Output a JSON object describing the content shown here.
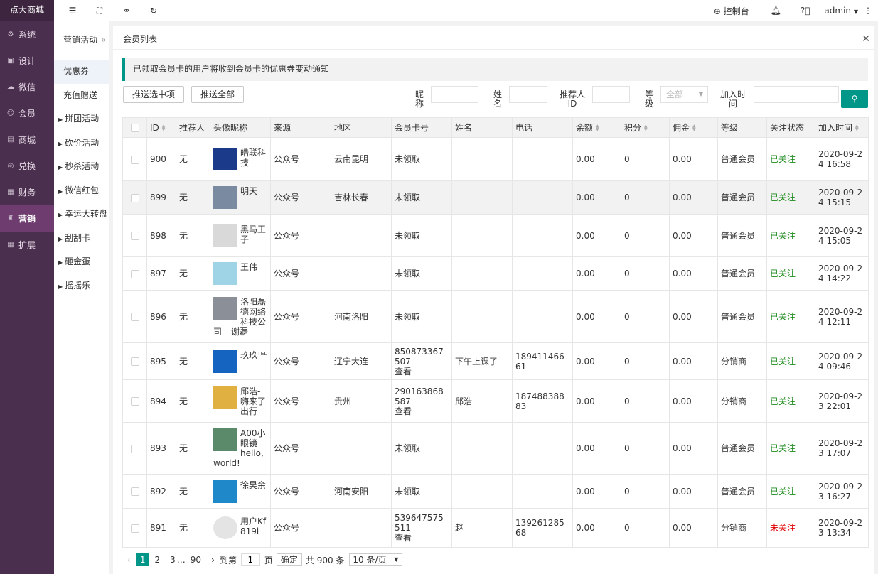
{
  "app_title": "点大商城",
  "sidebar": {
    "items": [
      {
        "label": "系统",
        "icon": "gear-icon",
        "glyph": "⚙"
      },
      {
        "label": "设计",
        "icon": "design-icon",
        "glyph": "▣"
      },
      {
        "label": "微信",
        "icon": "wechat-icon",
        "glyph": "☁"
      },
      {
        "label": "会员",
        "icon": "user-icon",
        "glyph": "☺"
      },
      {
        "label": "商城",
        "icon": "shop-icon",
        "glyph": "▤"
      },
      {
        "label": "兑换",
        "icon": "exchange-icon",
        "glyph": "◎"
      },
      {
        "label": "财务",
        "icon": "finance-icon",
        "glyph": "▦"
      },
      {
        "label": "营销",
        "icon": "marketing-icon",
        "glyph": "♜"
      },
      {
        "label": "扩展",
        "icon": "extend-icon",
        "glyph": "▦"
      }
    ],
    "active_index": 7
  },
  "subnav": {
    "title": "营销活动",
    "collapse": "«",
    "items": [
      {
        "label": "优惠券",
        "arrow": false
      },
      {
        "label": "充值赠送",
        "arrow": false
      },
      {
        "label": "拼团活动",
        "arrow": true
      },
      {
        "label": "砍价活动",
        "arrow": true
      },
      {
        "label": "秒杀活动",
        "arrow": true
      },
      {
        "label": "微信红包",
        "arrow": true
      },
      {
        "label": "幸运大转盘",
        "arrow": true
      },
      {
        "label": "刮刮卡",
        "arrow": true
      },
      {
        "label": "砸金蛋",
        "arrow": true
      },
      {
        "label": "摇摇乐",
        "arrow": true
      }
    ],
    "active_index": 0
  },
  "topbar": {
    "console": "控制台",
    "user": "admin"
  },
  "panel": {
    "title": "会员列表",
    "notice": "已领取会员卡的用户将收到会员卡的优惠券变动通知"
  },
  "toolbar": {
    "push_selected": "推送选中项",
    "push_all": "推送全部"
  },
  "filters": {
    "nickname": "昵称",
    "realname": "姓名",
    "referrer": "推荐人ID",
    "level": "等级",
    "level_value": "全部",
    "join_time": "加入时间"
  },
  "table": {
    "headers": {
      "id": "ID",
      "referrer": "推荐人",
      "nick": "头像昵称",
      "source": "来源",
      "region": "地区",
      "card": "会员卡号",
      "name": "姓名",
      "phone": "电话",
      "balance": "余额",
      "points": "积分",
      "commission": "佣金",
      "level": "等级",
      "follow": "关注状态",
      "joined": "加入时间"
    },
    "view_label": "查看",
    "rows": [
      {
        "id": "900",
        "referrer": "无",
        "nick": "皓联科技",
        "source": "公众号",
        "region": "云南昆明",
        "card": "未领取",
        "view": "",
        "name": "",
        "phone": "",
        "balance": "0.00",
        "points": "0",
        "commission": "0.00",
        "level": "普通会员",
        "follow": "已关注",
        "followed": true,
        "joined": "2020-09-24 16:58",
        "av": "#1b3a8a"
      },
      {
        "id": "899",
        "referrer": "无",
        "nick": "明天",
        "source": "公众号",
        "region": "吉林长春",
        "card": "未领取",
        "view": "",
        "name": "",
        "phone": "",
        "balance": "0.00",
        "points": "0",
        "commission": "0.00",
        "level": "普通会员",
        "follow": "已关注",
        "followed": true,
        "joined": "2020-09-24 15:15",
        "av": "#7a8aa0"
      },
      {
        "id": "898",
        "referrer": "无",
        "nick": "黑马王子",
        "source": "公众号",
        "region": "",
        "card": "未领取",
        "view": "",
        "name": "",
        "phone": "",
        "balance": "0.00",
        "points": "0",
        "commission": "0.00",
        "level": "普通会员",
        "follow": "已关注",
        "followed": true,
        "joined": "2020-09-24 15:05",
        "av": "#d9d9d9"
      },
      {
        "id": "897",
        "referrer": "无",
        "nick": "王伟",
        "source": "公众号",
        "region": "",
        "card": "未领取",
        "view": "",
        "name": "",
        "phone": "",
        "balance": "0.00",
        "points": "0",
        "commission": "0.00",
        "level": "普通会员",
        "follow": "已关注",
        "followed": true,
        "joined": "2020-09-24 14:22",
        "av": "#9fd3e6"
      },
      {
        "id": "896",
        "referrer": "无",
        "nick": "洛阳磊德网络科技公司---谢磊",
        "source": "公众号",
        "region": "河南洛阳",
        "card": "未领取",
        "view": "",
        "name": "",
        "phone": "",
        "balance": "0.00",
        "points": "0",
        "commission": "0.00",
        "level": "普通会员",
        "follow": "已关注",
        "followed": true,
        "joined": "2020-09-24 12:11",
        "av": "#8a8f98"
      },
      {
        "id": "895",
        "referrer": "无",
        "nick": "玖玖ᵀᴱᴸ",
        "source": "公众号",
        "region": "辽宁大连",
        "card": "850873367507",
        "view": "查看",
        "name": "下午上课了",
        "phone": "18941146661",
        "balance": "0.00",
        "points": "0",
        "commission": "0.00",
        "level": "分销商",
        "follow": "已关注",
        "followed": true,
        "joined": "2020-09-24 09:46",
        "av": "#1565c0"
      },
      {
        "id": "894",
        "referrer": "无",
        "nick": "邱浩-嗨来了出行",
        "source": "公众号",
        "region": "贵州",
        "card": "290163868587",
        "view": "查看",
        "name": "邱浩",
        "phone": "18748838883",
        "balance": "0.00",
        "points": "0",
        "commission": "0.00",
        "level": "分销商",
        "follow": "已关注",
        "followed": true,
        "joined": "2020-09-23 22:01",
        "av": "#e0b040"
      },
      {
        "id": "893",
        "referrer": "无",
        "nick": "A00小眼镜 _hello,world!",
        "source": "公众号",
        "region": "",
        "card": "未领取",
        "view": "",
        "name": "",
        "phone": "",
        "balance": "0.00",
        "points": "0",
        "commission": "0.00",
        "level": "普通会员",
        "follow": "已关注",
        "followed": true,
        "joined": "2020-09-23 17:07",
        "av": "#5a8a6a"
      },
      {
        "id": "892",
        "referrer": "无",
        "nick": "徐昊余",
        "source": "公众号",
        "region": "河南安阳",
        "card": "未领取",
        "view": "",
        "name": "",
        "phone": "",
        "balance": "0.00",
        "points": "0",
        "commission": "0.00",
        "level": "普通会员",
        "follow": "已关注",
        "followed": true,
        "joined": "2020-09-23 16:27",
        "av": "#1e88c8"
      },
      {
        "id": "891",
        "referrer": "无",
        "nick": "用户Kf819i",
        "source": "公众号",
        "region": "",
        "card": "539647575511",
        "view": "查看",
        "name": "赵",
        "phone": "13926128568",
        "balance": "0.00",
        "points": "0",
        "commission": "0.00",
        "level": "分销商",
        "follow": "未关注",
        "followed": false,
        "joined": "2020-09-23 13:34",
        "av": "#e4e4e4"
      }
    ]
  },
  "pager": {
    "prev": "‹",
    "next": "›",
    "pages": [
      "1",
      "2",
      "3"
    ],
    "ellipsis": "…",
    "last": "90",
    "goto": "到第",
    "goto_value": "1",
    "page_unit": "页",
    "confirm": "确定",
    "total": "共 900 条",
    "page_size": "10 条/页"
  },
  "colors": {
    "sidebar": "#4b2f4e",
    "accent": "#009688",
    "followed": "#1e8a1e",
    "unfollowed": "#e00000"
  }
}
